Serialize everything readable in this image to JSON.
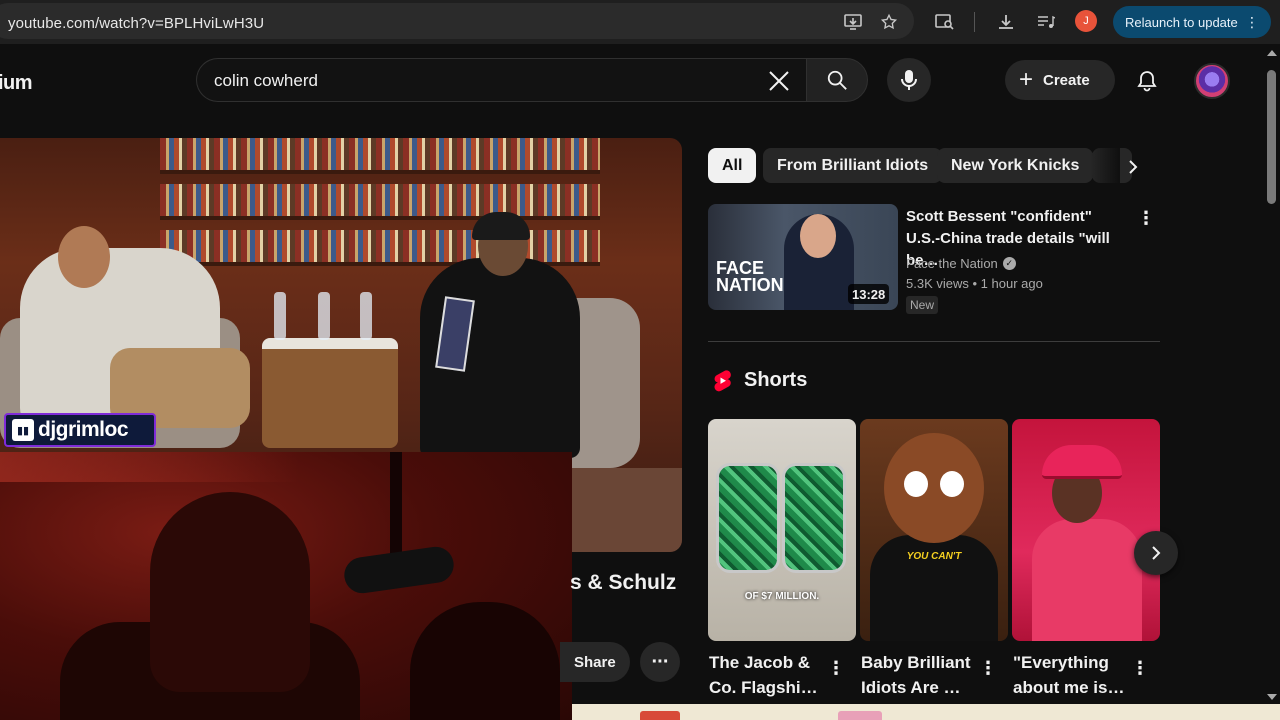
{
  "browser": {
    "url": "youtube.com/watch?v=BPLHviLwH3U",
    "profile_initial": "J",
    "relaunch_label": "Relaunch to update"
  },
  "header": {
    "logo_partial": "ium",
    "search_value": "colin cowherd",
    "create_label": "Create"
  },
  "player": {
    "streamer_name": "djgrimloc"
  },
  "video": {
    "title_partial": "s & Schulz",
    "share_label": "Share"
  },
  "chips": [
    "All",
    "From Brilliant Idiots",
    "New York Knicks"
  ],
  "recommended": {
    "title": "Scott Bessent \"confident\" U.S.-China trade details \"will be…",
    "channel": "Face the Nation",
    "views": "5.3K views",
    "age": "1 hour ago",
    "badge": "New",
    "duration": "13:28",
    "thumb_logo_line1": "FACE",
    "thumb_logo_line2": "NATION"
  },
  "shorts": {
    "section_title": "Shorts",
    "items": [
      {
        "title": "The Jacob & Co. Flagshi…",
        "caption": "OF $7 MILLION."
      },
      {
        "title": "Baby Brilliant Idiots Are …",
        "caption": "YOU CAN'T"
      },
      {
        "title": "\"Everything about me is…",
        "caption": ""
      }
    ]
  },
  "colors": {
    "background": "#0f0f0f",
    "relaunch_bg": "#0b4a6f",
    "shorts_red": "#ff0033",
    "twitch_purple": "#7f2bd8"
  }
}
